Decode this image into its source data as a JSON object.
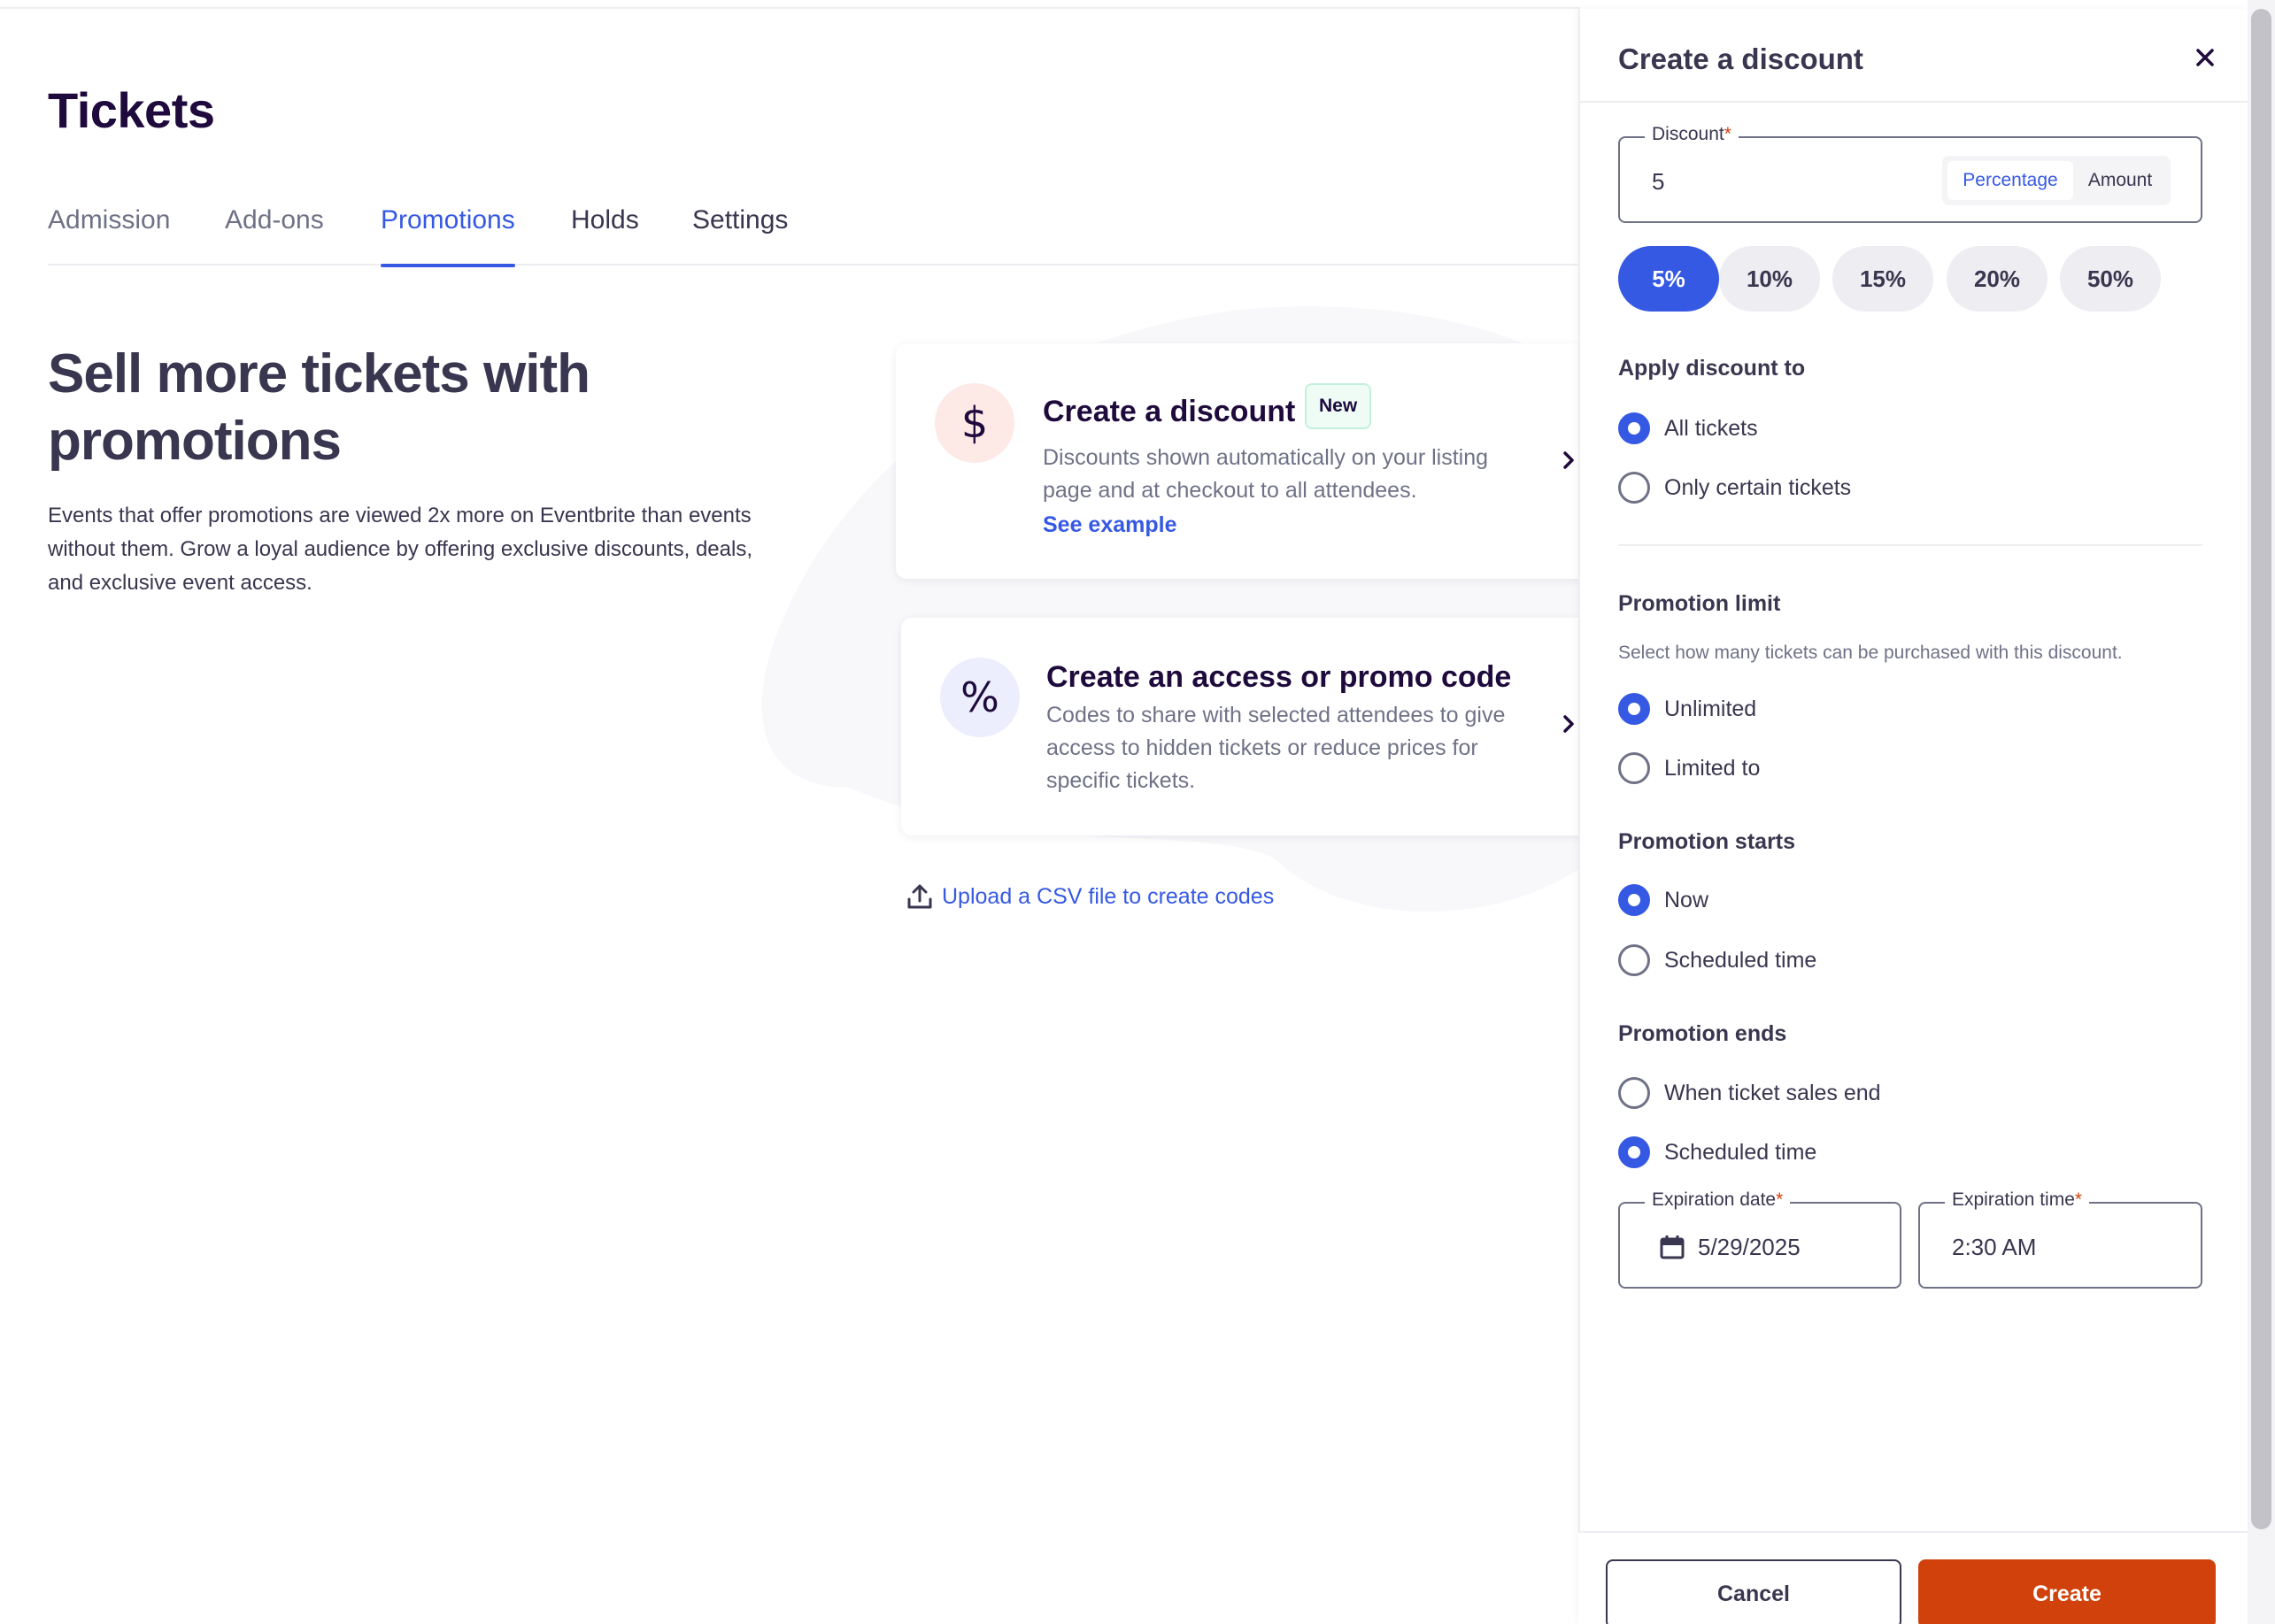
{
  "page": {
    "title": "Tickets",
    "tabs": [
      {
        "label": "Admission"
      },
      {
        "label": "Add-ons"
      },
      {
        "label": "Promotions"
      },
      {
        "label": "Holds"
      },
      {
        "label": "Settings"
      }
    ],
    "active_tab": "Promotions"
  },
  "hero": {
    "title": "Sell more tickets with promotions",
    "description": "Events that offer promotions are viewed 2x more on Eventbrite than events without them. Grow a loyal audience by offering exclusive discounts, deals, and exclusive event access."
  },
  "cards": {
    "discount": {
      "icon": "dollar-icon",
      "title": "Create a discount",
      "badge": "New",
      "description": "Discounts shown automatically on your listing page and at checkout to all attendees.",
      "link": "See example"
    },
    "promo": {
      "icon": "percent-icon",
      "title": "Create an access or promo code",
      "description": "Codes to share with selected attendees to give access to hidden tickets or reduce prices for specific tickets."
    }
  },
  "upload": {
    "icon": "upload-icon",
    "label": "Upload a CSV file to create codes"
  },
  "panel": {
    "title": "Create a discount",
    "discount_field": {
      "label": "Discount",
      "required_mark": "*",
      "value": "5",
      "type_options": [
        "Percentage",
        "Amount"
      ],
      "selected_type": "Percentage"
    },
    "quick_values": [
      "5%",
      "10%",
      "15%",
      "20%",
      "50%"
    ],
    "selected_quick_value": "5%",
    "apply_to": {
      "heading": "Apply discount to",
      "options": [
        "All tickets",
        "Only certain tickets"
      ],
      "selected": "All tickets"
    },
    "limit": {
      "heading": "Promotion limit",
      "subtext": "Select how many tickets can be purchased with this discount.",
      "options": [
        "Unlimited",
        "Limited to"
      ],
      "selected": "Unlimited"
    },
    "starts": {
      "heading": "Promotion starts",
      "options": [
        "Now",
        "Scheduled time"
      ],
      "selected": "Now"
    },
    "ends": {
      "heading": "Promotion ends",
      "options": [
        "When ticket sales end",
        "Scheduled time"
      ],
      "selected": "Scheduled time"
    },
    "expiration_date": {
      "label": "Expiration date",
      "required_mark": "*",
      "value": "5/29/2025",
      "icon": "calendar-icon"
    },
    "expiration_time": {
      "label": "Expiration time",
      "required_mark": "*",
      "value": "2:30 AM"
    },
    "cancel_label": "Cancel",
    "create_label": "Create"
  },
  "colors": {
    "accent": "#3659e3",
    "primary_button": "#d1410c",
    "text": "#39364f",
    "heading": "#1e0a3c",
    "muted": "#6f7287"
  }
}
